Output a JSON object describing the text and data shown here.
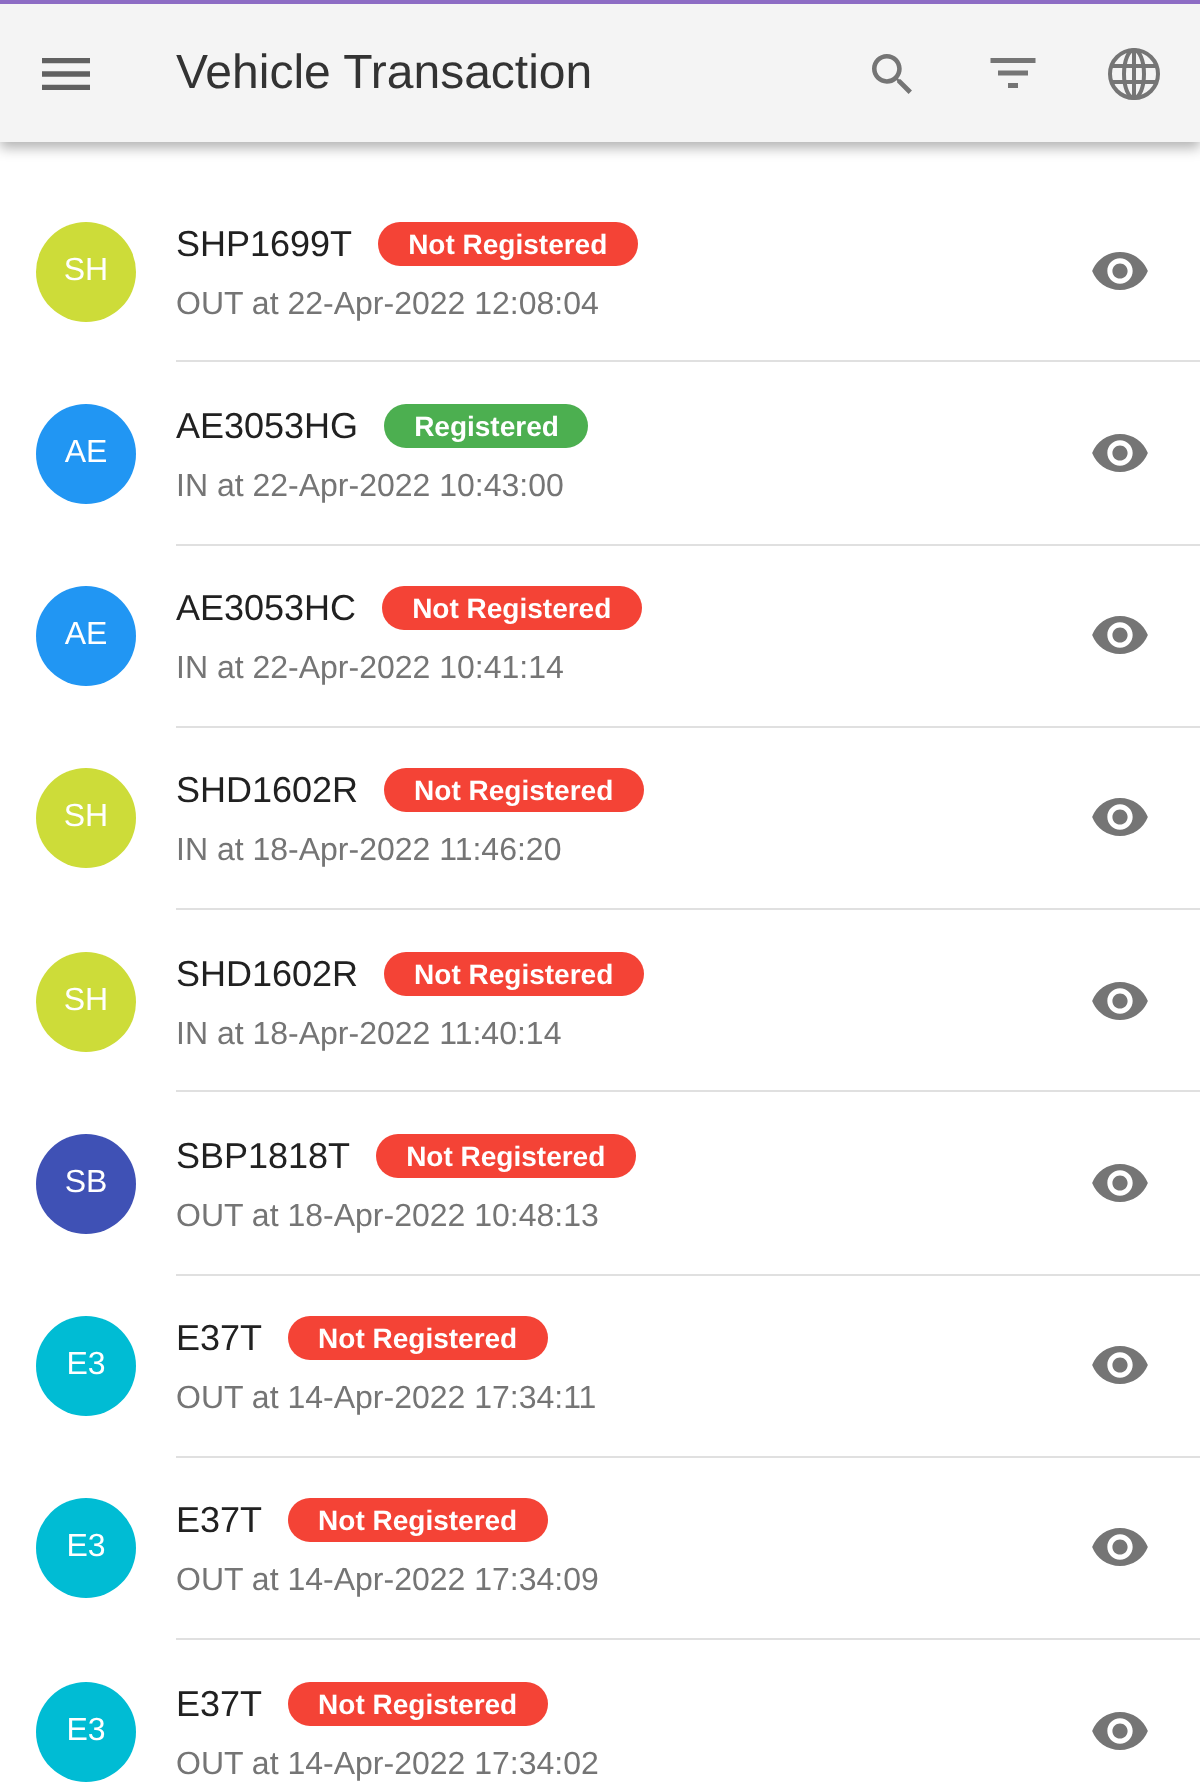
{
  "app_bar": {
    "title": "Vehicle Transaction"
  },
  "transactions": [
    {
      "avatar": "SH",
      "color": "#cddc39",
      "plate": "SHP1699T",
      "status": {
        "label": "Not Registered",
        "registered": false
      },
      "detail": "OUT at 22-Apr-2022 12:08:04"
    },
    {
      "avatar": "AE",
      "color": "#2196f3",
      "plate": "AE3053HG",
      "status": {
        "label": "Registered",
        "registered": true
      },
      "detail": "IN at 22-Apr-2022 10:43:00"
    },
    {
      "avatar": "AE",
      "color": "#2196f3",
      "plate": "AE3053HC",
      "status": {
        "label": "Not Registered",
        "registered": false
      },
      "detail": "IN at 22-Apr-2022 10:41:14"
    },
    {
      "avatar": "SH",
      "color": "#cddc39",
      "plate": "SHD1602R",
      "status": {
        "label": "Not Registered",
        "registered": false
      },
      "detail": "IN at 18-Apr-2022 11:46:20"
    },
    {
      "avatar": "SH",
      "color": "#cddc39",
      "plate": "SHD1602R",
      "status": {
        "label": "Not Registered",
        "registered": false
      },
      "detail": "IN at 18-Apr-2022 11:40:14"
    },
    {
      "avatar": "SB",
      "color": "#3f51b5",
      "plate": "SBP1818T",
      "status": {
        "label": "Not Registered",
        "registered": false
      },
      "detail": "OUT at 18-Apr-2022 10:48:13"
    },
    {
      "avatar": "E3",
      "color": "#00bcd4",
      "plate": "E37T",
      "status": {
        "label": "Not Registered",
        "registered": false
      },
      "detail": "OUT at 14-Apr-2022 17:34:11"
    },
    {
      "avatar": "E3",
      "color": "#00bcd4",
      "plate": "E37T",
      "status": {
        "label": "Not Registered",
        "registered": false
      },
      "detail": "OUT at 14-Apr-2022 17:34:09"
    },
    {
      "avatar": "E3",
      "color": "#00bcd4",
      "plate": "E37T",
      "status": {
        "label": "Not Registered",
        "registered": false
      },
      "detail": "OUT at 14-Apr-2022 17:34:02"
    }
  ]
}
